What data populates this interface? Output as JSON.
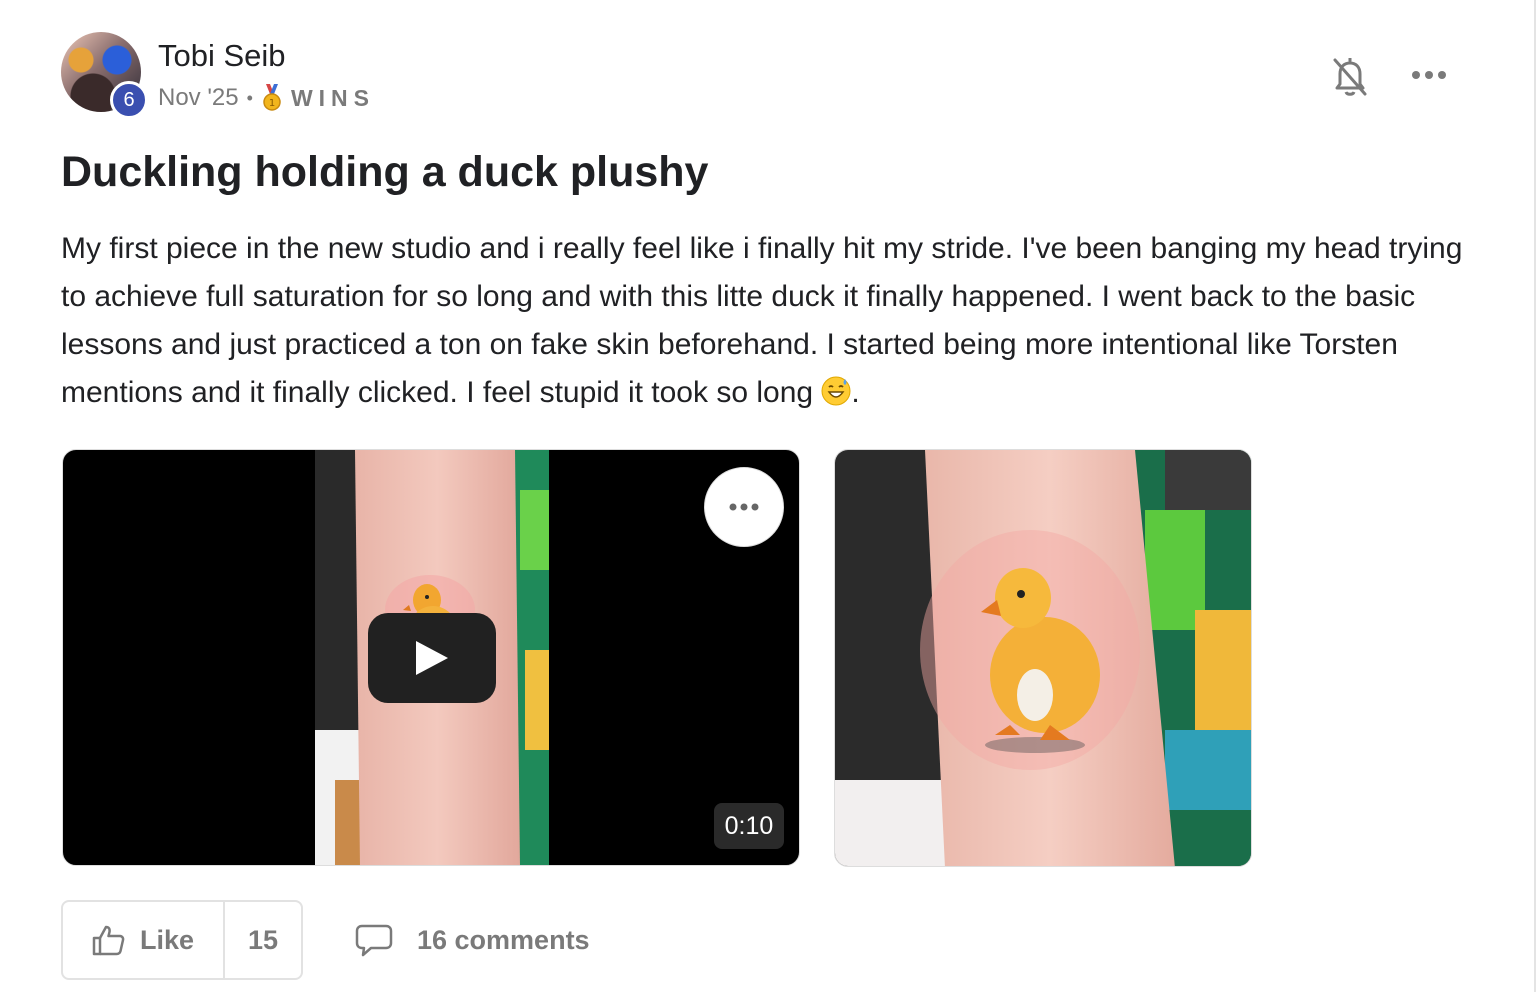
{
  "author": {
    "name": "Tobi Seib",
    "level": "6",
    "avatar_icon": "avatar-photo"
  },
  "meta": {
    "date": "Nov '25",
    "separator": "•",
    "category_icon": "gold-medal-icon",
    "category": "WINS"
  },
  "actions": {
    "notification_icon": "bell-off-icon",
    "more_icon": "more-horizontal-icon"
  },
  "post": {
    "title": "Duckling holding a duck plushy",
    "body": "My first piece in the new studio and i really feel like i finally hit my stride. I've been banging my head trying to achieve full saturation for so long and with this litte duck it finally happened. I went back to the basic lessons and just practiced a ton on fake skin beforehand. I started being more intentional like Torsten mentions and it finally clicked. I feel stupid it took so long",
    "body_end_emoji": "grinning-sweat-emoji",
    "body_end": "."
  },
  "media": {
    "video": {
      "duration": "0:10",
      "play_icon": "play-icon",
      "more_icon": "more-horizontal-icon"
    },
    "image": {
      "subject": "duckling-tattoo-photo"
    }
  },
  "footer": {
    "like_label": "Like",
    "like_count": "15",
    "comments_label": "16 comments",
    "like_icon": "thumbs-up-icon",
    "comment_icon": "comment-icon"
  },
  "colors": {
    "level_badge": "#3a4fb0",
    "muted_text": "#7a7a7a",
    "video_bg": "#000000"
  }
}
